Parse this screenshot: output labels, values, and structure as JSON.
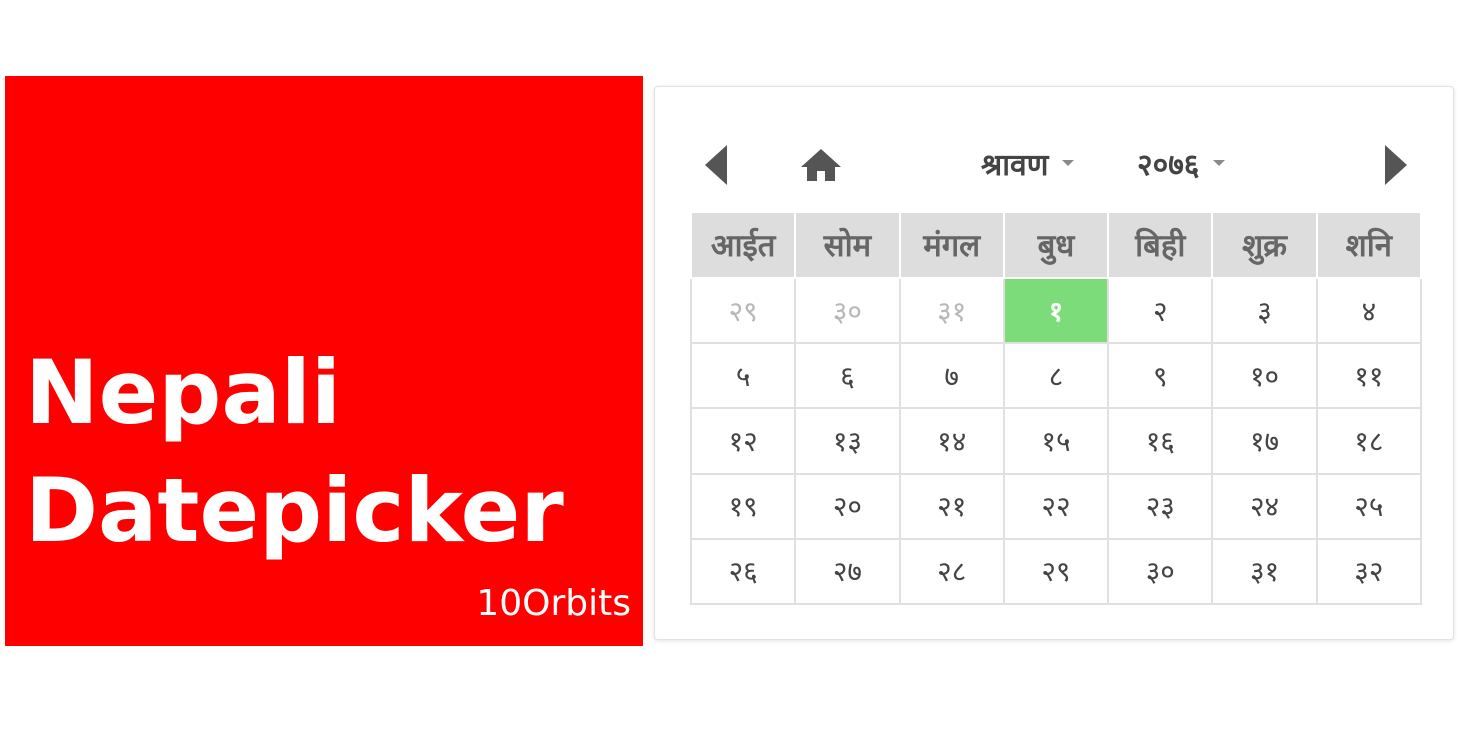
{
  "banner": {
    "title_line1": "Nepali",
    "title_line2": "Datepicker",
    "brand": "10Orbits",
    "background_color": "#ff0000"
  },
  "picker": {
    "month": "श्रावण",
    "year": "२०७६",
    "icons": {
      "prev": "triangle-left-icon",
      "next": "triangle-right-icon",
      "home": "home-icon"
    },
    "weekdays": [
      "आईत",
      "सोम",
      "मंगल",
      "बुध",
      "बिही",
      "शुक्र",
      "शनि"
    ],
    "weeks": [
      [
        {
          "d": "२९",
          "muted": true
        },
        {
          "d": "३०",
          "muted": true
        },
        {
          "d": "३१",
          "muted": true
        },
        {
          "d": "१",
          "today": true
        },
        {
          "d": "२"
        },
        {
          "d": "३"
        },
        {
          "d": "४"
        }
      ],
      [
        {
          "d": "५"
        },
        {
          "d": "६"
        },
        {
          "d": "७"
        },
        {
          "d": "८"
        },
        {
          "d": "९"
        },
        {
          "d": "१०"
        },
        {
          "d": "११"
        }
      ],
      [
        {
          "d": "१२"
        },
        {
          "d": "१३"
        },
        {
          "d": "१४"
        },
        {
          "d": "१५"
        },
        {
          "d": "१६"
        },
        {
          "d": "१७"
        },
        {
          "d": "१८"
        }
      ],
      [
        {
          "d": "१९"
        },
        {
          "d": "२०"
        },
        {
          "d": "२१"
        },
        {
          "d": "२२"
        },
        {
          "d": "२३"
        },
        {
          "d": "२४"
        },
        {
          "d": "२५"
        }
      ],
      [
        {
          "d": "२६"
        },
        {
          "d": "२७"
        },
        {
          "d": "२८"
        },
        {
          "d": "२९"
        },
        {
          "d": "३०"
        },
        {
          "d": "३१"
        },
        {
          "d": "३२"
        }
      ]
    ],
    "colors": {
      "selected": "#7ddc7a",
      "header_bg": "#dddddd",
      "muted_text": "#b8b8b8"
    }
  }
}
